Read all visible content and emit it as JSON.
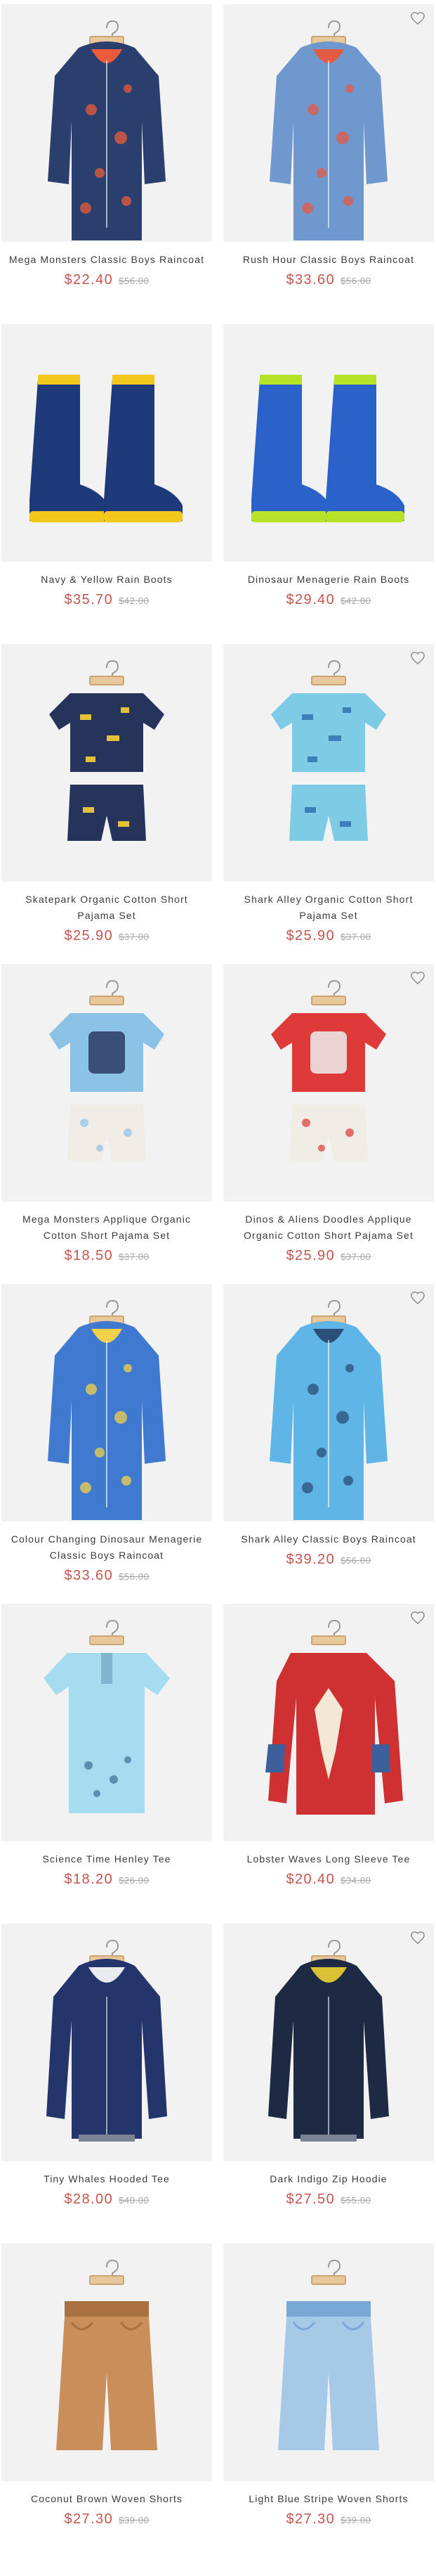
{
  "products": [
    {
      "name": "Mega Monsters Classic Boys Raincoat",
      "price": "$22.40",
      "was": "$56.00",
      "wishlist": false,
      "kind": "raincoat",
      "main": "#2b3f6e",
      "accent": "#e95b3b"
    },
    {
      "name": "Rush Hour Classic Boys Raincoat",
      "price": "$33.60",
      "was": "$56.00",
      "wishlist": true,
      "kind": "raincoat",
      "main": "#6f98cf",
      "accent": "#e35a45"
    },
    {
      "name": "Navy & Yellow Rain Boots",
      "price": "$35.70",
      "was": "$42.00",
      "wishlist": false,
      "kind": "boots",
      "main": "#1f3a7a",
      "accent": "#f3c81d"
    },
    {
      "name": "Dinosaur Menagerie Rain Boots",
      "price": "$29.40",
      "was": "$42.00",
      "wishlist": false,
      "kind": "boots",
      "main": "#2b62c9",
      "accent": "#b7e22a"
    },
    {
      "name": "Skatepark Organic Cotton Short Pajama Set",
      "price": "$25.90",
      "was": "$37.00",
      "wishlist": false,
      "kind": "pajama",
      "main": "#26345c",
      "accent": "#e4c13a"
    },
    {
      "name": "Shark Alley Organic Cotton Short Pajama Set",
      "price": "$25.90",
      "was": "$37.00",
      "wishlist": true,
      "kind": "pajama",
      "main": "#7ecbe6",
      "accent": "#3d7fb8"
    },
    {
      "name": "Mega Monsters Applique Organic Cotton Short Pajama Set",
      "price": "$18.50",
      "was": "$37.00",
      "wishlist": false,
      "kind": "pajama2",
      "main": "#8cc2e6",
      "accent": "#2c3a66"
    },
    {
      "name": "Dinos & Aliens Doodles Applique Organic Cotton Short Pajama Set",
      "price": "$25.90",
      "was": "$37.00",
      "wishlist": true,
      "kind": "pajama2",
      "main": "#de3a3a",
      "accent": "#eeeeee"
    },
    {
      "name": "Colour Changing Dinosaur Menagerie Classic Boys Raincoat",
      "price": "$33.60",
      "was": "$56.00",
      "wishlist": false,
      "kind": "raincoat",
      "main": "#3f79d0",
      "accent": "#f2d14a"
    },
    {
      "name": "Shark Alley Classic Boys Raincoat",
      "price": "$39.20",
      "was": "$56.00",
      "wishlist": true,
      "kind": "raincoat",
      "main": "#5fb5e5",
      "accent": "#2a4f7a"
    },
    {
      "name": "Science Time Henley Tee",
      "price": "$18.20",
      "was": "$26.00",
      "wishlist": false,
      "kind": "tee",
      "main": "#a6dcef",
      "accent": "#5a8fb0"
    },
    {
      "name": "Lobster Waves Long Sleeve Tee",
      "price": "$20.40",
      "was": "$34.00",
      "wishlist": true,
      "kind": "longtee",
      "main": "#cf3133",
      "accent": "#3d5f9c"
    },
    {
      "name": "Tiny Whales Hooded Tee",
      "price": "$28.00",
      "was": "$40.00",
      "wishlist": false,
      "kind": "hoodie",
      "main": "#24356b",
      "accent": "#ffffff"
    },
    {
      "name": "Dark Indigo Zip Hoodie",
      "price": "$27.50",
      "was": "$55.00",
      "wishlist": true,
      "kind": "hoodie",
      "main": "#1e2a44",
      "accent": "#f0d234"
    },
    {
      "name": "Coconut Brown Woven Shorts",
      "price": "$27.30",
      "was": "$39.00",
      "wishlist": false,
      "kind": "shorts",
      "main": "#c98e5a",
      "accent": "#a8713f"
    },
    {
      "name": "Light Blue Stripe Woven Shorts",
      "price": "$27.30",
      "was": "$39.00",
      "wishlist": false,
      "kind": "shorts",
      "main": "#a7c9e8",
      "accent": "#7aa8d6"
    }
  ]
}
